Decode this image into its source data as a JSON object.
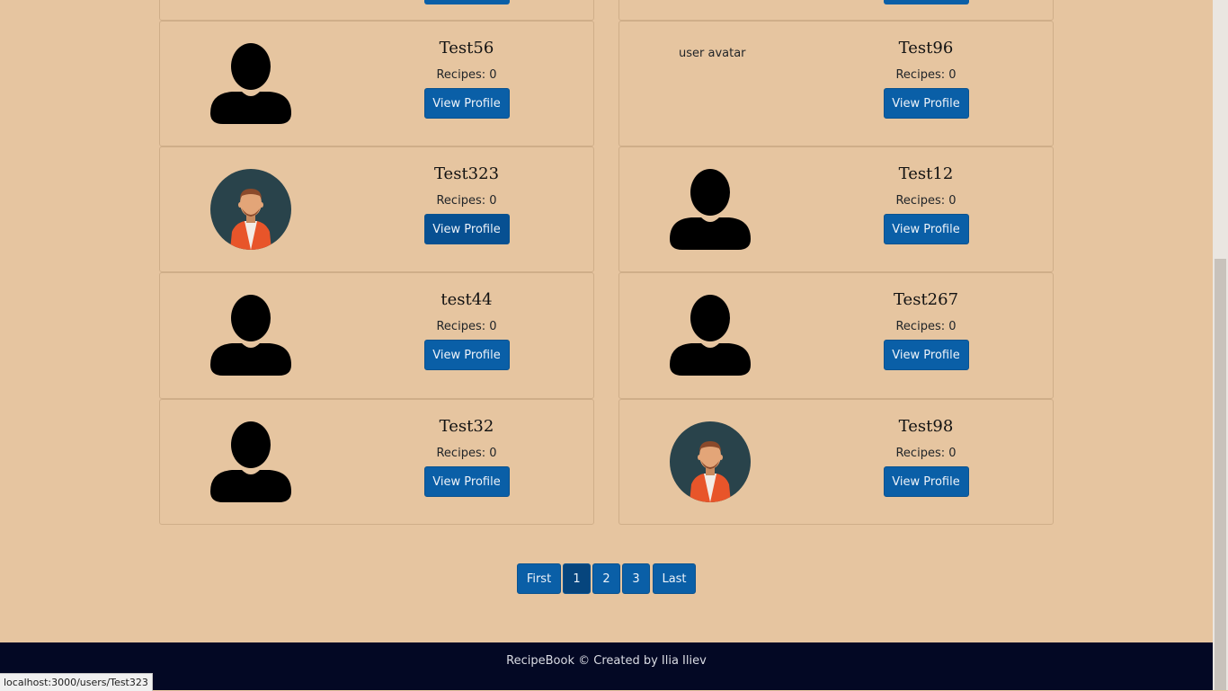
{
  "users": [
    {
      "name": "Test56",
      "recipes": "Recipes: 0",
      "avatar": "silhouette",
      "button": "View Profile"
    },
    {
      "name": "Test96",
      "recipes": "Recipes: 0",
      "avatar": "broken",
      "avatar_alt": "user avatar",
      "button": "View Profile"
    },
    {
      "name": "Test323",
      "recipes": "Recipes: 0",
      "avatar": "man",
      "button": "View Profile"
    },
    {
      "name": "Test12",
      "recipes": "Recipes: 0",
      "avatar": "silhouette",
      "button": "View Profile"
    },
    {
      "name": "test44",
      "recipes": "Recipes: 0",
      "avatar": "silhouette",
      "button": "View Profile"
    },
    {
      "name": "Test267",
      "recipes": "Recipes: 0",
      "avatar": "silhouette",
      "button": "View Profile"
    },
    {
      "name": "Test32",
      "recipes": "Recipes: 0",
      "avatar": "silhouette",
      "button": "View Profile"
    },
    {
      "name": "Test98",
      "recipes": "Recipes: 0",
      "avatar": "man",
      "button": "View Profile"
    }
  ],
  "pagination": {
    "first": "First",
    "pages": [
      "1",
      "2",
      "3"
    ],
    "active_page": "1",
    "last": "Last"
  },
  "footer": {
    "text": "RecipeBook © Created by Ilia Iliev"
  },
  "status_bar": {
    "url": "localhost:3000/users/Test323"
  },
  "colors": {
    "page_bg": "#e6c5a0",
    "button": "#0a5fa7",
    "footer_bg": "#030824",
    "avatar_bg": "#29434b",
    "jacket": "#e8552a"
  }
}
